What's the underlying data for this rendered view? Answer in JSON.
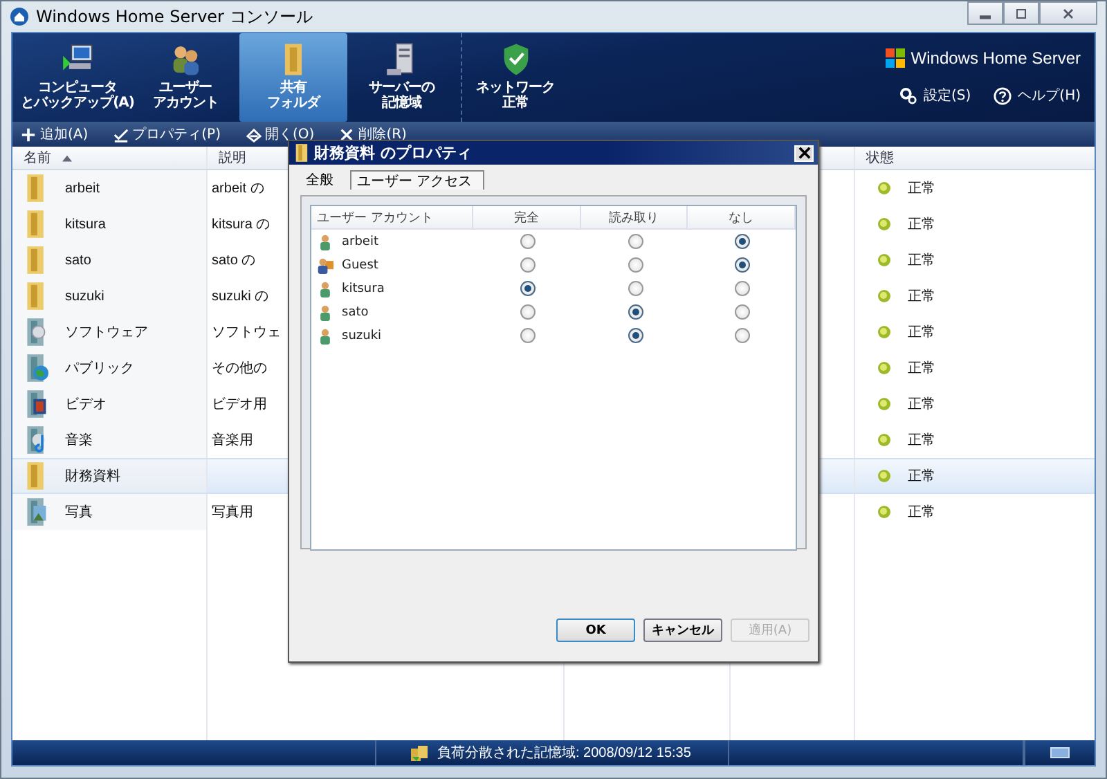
{
  "window": {
    "title": "Windows Home Server コンソール"
  },
  "nav_tabs": [
    {
      "kind": "computer",
      "lines": [
        "コンピュータ",
        "とバックアップ(A)"
      ],
      "selected": false
    },
    {
      "kind": "users",
      "lines": [
        "ユーザー",
        "アカウント"
      ],
      "selected": false
    },
    {
      "kind": "folder",
      "lines": [
        "共有",
        "フォルダ"
      ],
      "selected": true
    },
    {
      "kind": "server",
      "lines": [
        "サーバーの",
        "記憶域"
      ],
      "selected": false
    },
    {
      "kind": "network",
      "lines": [
        "ネットワーク",
        "正常"
      ],
      "selected": false
    }
  ],
  "brand": "Windows Home Server",
  "header_links": [
    {
      "kind": "settings",
      "label": "設定(S)"
    },
    {
      "kind": "help",
      "label": "ヘルプ(H)"
    }
  ],
  "toolbar": [
    {
      "kind": "add",
      "label": "追加(A)"
    },
    {
      "kind": "properties",
      "label": "プロパティ(P)"
    },
    {
      "kind": "open",
      "label": "開く(O)"
    },
    {
      "kind": "delete",
      "label": "削除(R)"
    }
  ],
  "table": {
    "columns": [
      "名前",
      "説明",
      "状態"
    ],
    "rows": [
      {
        "kind": "folder",
        "name": "arbeit",
        "description": "arbeit の",
        "status": "正常",
        "selected": false
      },
      {
        "kind": "folder",
        "name": "kitsura",
        "description": "kitsura の",
        "status": "正常",
        "selected": false
      },
      {
        "kind": "folder",
        "name": "sato",
        "description": "sato の",
        "status": "正常",
        "selected": false
      },
      {
        "kind": "folder",
        "name": "suzuki",
        "description": "suzuki の",
        "status": "正常",
        "selected": false
      },
      {
        "kind": "software",
        "name": "ソフトウェア",
        "description": "ソフトウェ",
        "status": "正常",
        "selected": false
      },
      {
        "kind": "public",
        "name": "パブリック",
        "description": "その他の",
        "status": "正常",
        "selected": false
      },
      {
        "kind": "video",
        "name": "ビデオ",
        "description": "ビデオ用",
        "status": "正常",
        "selected": false
      },
      {
        "kind": "music",
        "name": "音楽",
        "description": "音楽用",
        "status": "正常",
        "selected": false
      },
      {
        "kind": "folder",
        "name": "財務資料",
        "status": "正常",
        "selected": true
      },
      {
        "kind": "photo",
        "name": "写真",
        "description": "写真用",
        "status": "正常",
        "selected": false
      }
    ]
  },
  "dialog": {
    "title": "財務資料 のプロパティ",
    "tabs": [
      {
        "label": "全般",
        "selected": false
      },
      {
        "label": "ユーザー アクセス",
        "selected": true
      }
    ],
    "columns": [
      "ユーザー アカウント",
      "完全",
      "読み取り",
      "なし"
    ],
    "users": [
      {
        "kind": "user",
        "name": "arbeit",
        "options": [
          {
            "selected": false
          },
          {
            "selected": false
          },
          {
            "selected": true
          }
        ]
      },
      {
        "kind": "guest",
        "name": "Guest",
        "options": [
          {
            "selected": false
          },
          {
            "selected": false
          },
          {
            "selected": true
          }
        ]
      },
      {
        "kind": "user",
        "name": "kitsura",
        "options": [
          {
            "selected": true
          },
          {
            "selected": false
          },
          {
            "selected": false
          }
        ]
      },
      {
        "kind": "user",
        "name": "sato",
        "options": [
          {
            "selected": false
          },
          {
            "selected": true
          },
          {
            "selected": false
          }
        ]
      },
      {
        "kind": "user",
        "name": "suzuki",
        "options": [
          {
            "selected": false
          },
          {
            "selected": true
          },
          {
            "selected": false
          }
        ]
      }
    ],
    "buttons": [
      {
        "label": "OK",
        "disabled": false
      },
      {
        "label": "キャンセル",
        "disabled": false
      },
      {
        "label": "適用(A)",
        "disabled": true
      }
    ]
  },
  "status_bar": {
    "text": "負荷分散された記憶域: 2008/09/12 15:35"
  }
}
